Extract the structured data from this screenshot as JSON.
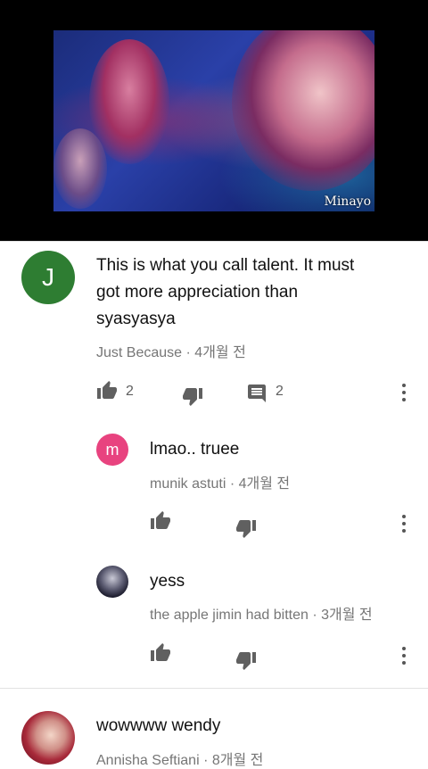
{
  "video": {
    "watermark": "Minayo"
  },
  "comments": [
    {
      "avatar_letter": "J",
      "avatar_color": "#2e7d32",
      "lines": [
        "This is what you call talent. It must",
        "got more appreciation than",
        "syasyasya"
      ],
      "author": "Just Because",
      "time": "· 4개월 전",
      "likes": "2",
      "replies_count": "2",
      "replies": [
        {
          "avatar_letter": "m",
          "avatar_color": "#e8437f",
          "text": "lmao.. truee",
          "author": "munik astuti",
          "time": "· 4개월 전"
        },
        {
          "avatar_letter": "",
          "text": "yess",
          "author": "the apple jimin had bitten",
          "time": "· 3개월 전"
        }
      ]
    },
    {
      "text": "wowwww wendy",
      "author": "Annisha Seftiani",
      "time": "· 8개월 전"
    }
  ],
  "icons": {
    "like": "thumb-up-icon",
    "dislike": "thumb-down-icon",
    "reply": "comment-icon",
    "more": "more-vert-icon"
  }
}
